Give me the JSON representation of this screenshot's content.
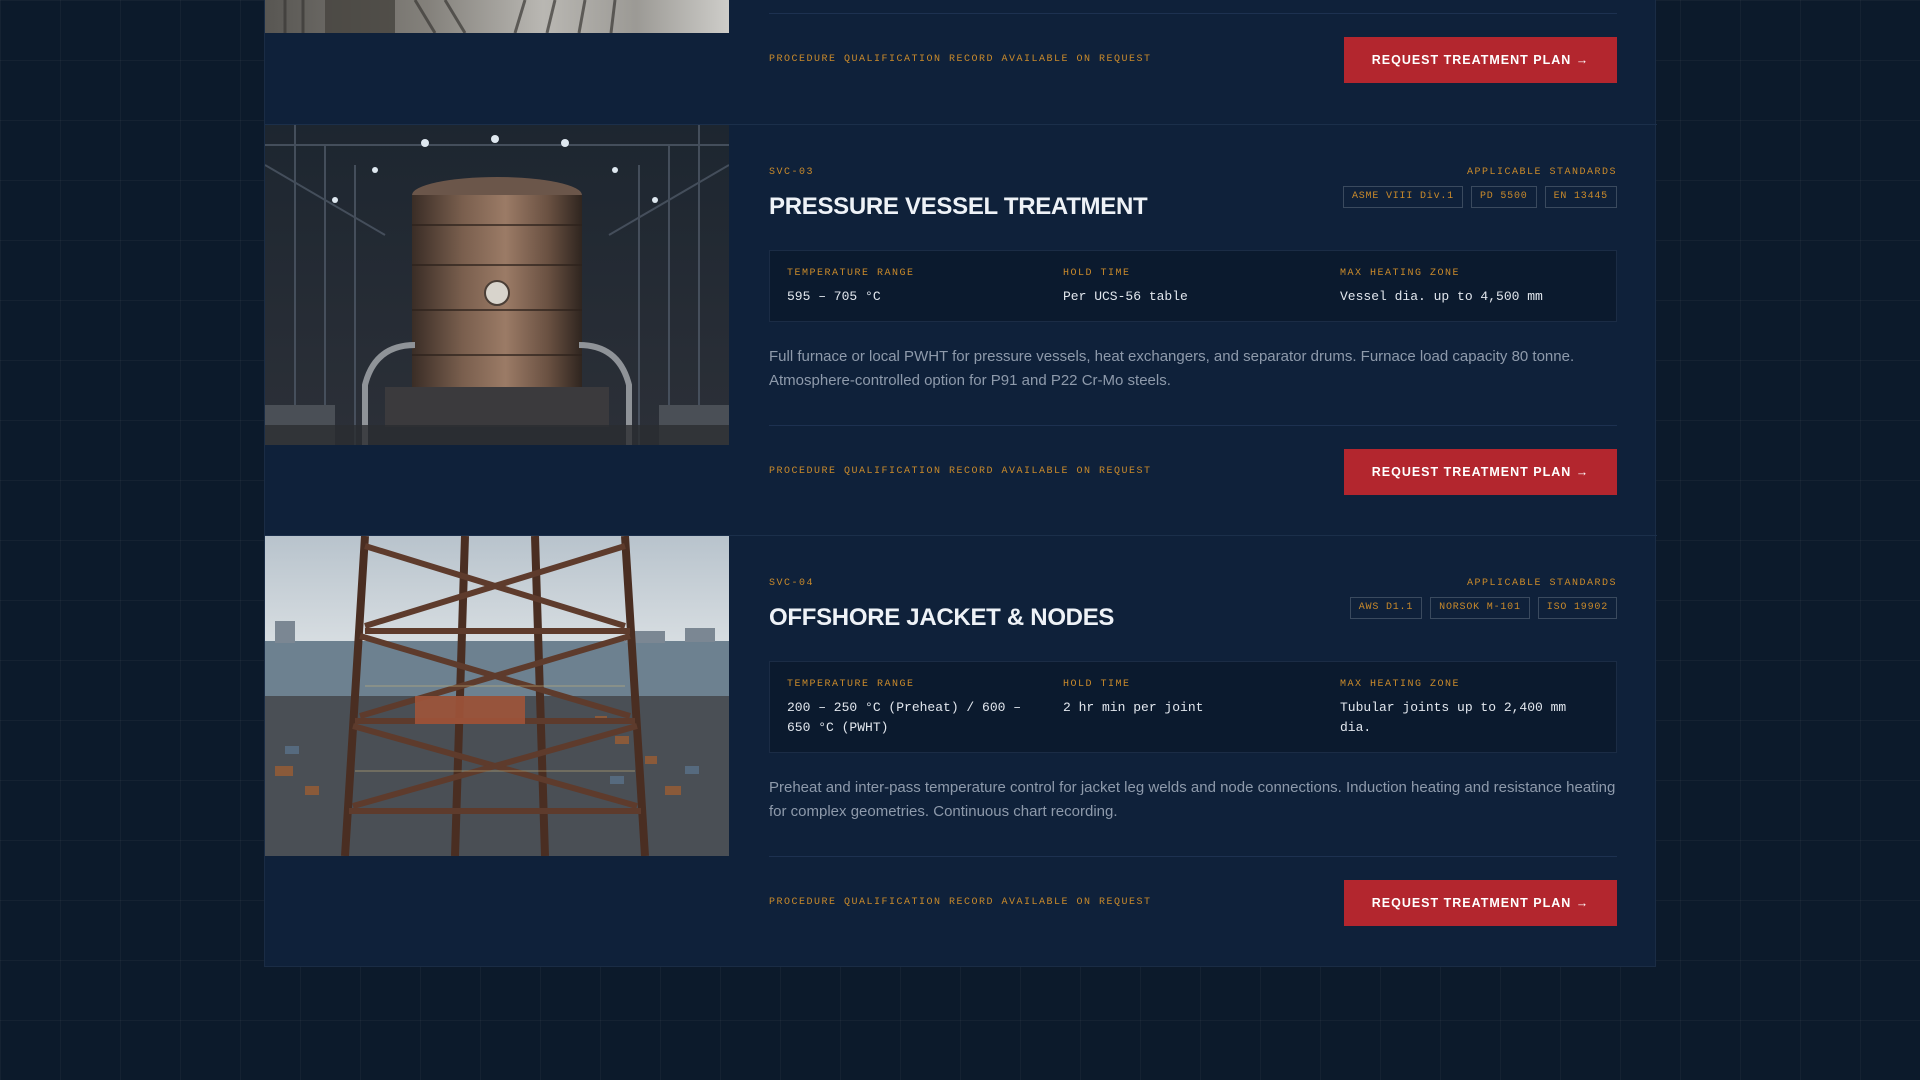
{
  "cards": [
    {
      "pqr_note": "PROCEDURE QUALIFICATION RECORD AVAILABLE ON REQUEST",
      "cta_label": "REQUEST TREATMENT PLAN →"
    },
    {
      "code": "SVC-03",
      "title": "PRESSURE VESSEL TREATMENT",
      "standards_label": "APPLICABLE STANDARDS",
      "standards": [
        "ASME VIII Div.1",
        "PD 5500",
        "EN 13445"
      ],
      "specs": [
        {
          "label": "TEMPERATURE RANGE",
          "value": "595 – 705 °C"
        },
        {
          "label": "HOLD TIME",
          "value": "Per UCS-56 table"
        },
        {
          "label": "MAX HEATING ZONE",
          "value": "Vessel dia. up to 4,500 mm"
        }
      ],
      "description": "Full furnace or local PWHT for pressure vessels, heat exchangers, and separator drums. Furnace load capacity 80 tonne. Atmosphere-controlled option for P91 and P22 Cr-Mo steels.",
      "pqr_note": "PROCEDURE QUALIFICATION RECORD AVAILABLE ON REQUEST",
      "cta_label": "REQUEST TREATMENT PLAN →"
    },
    {
      "code": "SVC-04",
      "title": "OFFSHORE JACKET & NODES",
      "standards_label": "APPLICABLE STANDARDS",
      "standards": [
        "AWS D1.1",
        "NORSOK M-101",
        "ISO 19902"
      ],
      "specs": [
        {
          "label": "TEMPERATURE RANGE",
          "value": "200 – 250 °C (Preheat) / 600 – 650 °C (PWHT)"
        },
        {
          "label": "HOLD TIME",
          "value": "2 hr min per joint"
        },
        {
          "label": "MAX HEATING ZONE",
          "value": "Tubular joints up to 2,400 mm dia."
        }
      ],
      "description": "Preheat and inter-pass temperature control for jacket leg welds and node connections. Induction heating and resistance heating for complex geometries. Continuous chart recording.",
      "pqr_note": "PROCEDURE QUALIFICATION RECORD AVAILABLE ON REQUEST",
      "cta_label": "REQUEST TREATMENT PLAN →"
    }
  ]
}
